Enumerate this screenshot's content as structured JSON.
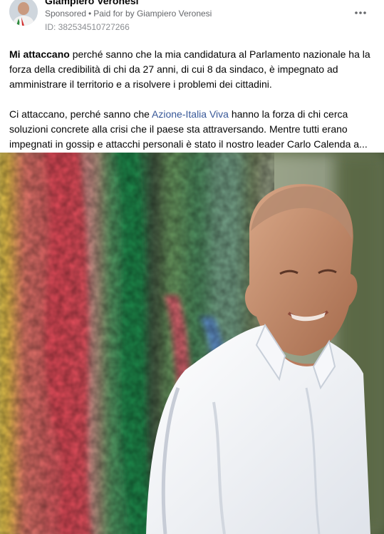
{
  "post": {
    "author": "Giampiero Veronesi",
    "sponsored": "Sponsored",
    "separator": "•",
    "paid_for": "Paid for by Giampiero Veronesi",
    "ad_id": "ID: 382534510727266",
    "more_icon": "more-horizontal-icon",
    "paragraph1_bold": "Mi attaccano",
    "paragraph1_rest": " perché sanno che la mia candidatura al Parlamento nazionale ha la forza della credibilità di chi da 27 anni, di cui 8 da sindaco, è impegnato ad amministrare il territorio e a risolvere i problemi dei cittadini.",
    "paragraph2_start": "Ci attaccano, perché sanno che ",
    "paragraph2_link": "Azione-Italia Viva",
    "paragraph2_rest": " hanno la forza di chi cerca soluzioni concrete alla crisi che il paese sta attraversando. Mentre tutti erano impegnati in gossip e attacchi personali è stato il nostro leader Carlo Calenda a..."
  },
  "colors": {
    "link": "#385898",
    "secondary_text": "#65676b"
  }
}
